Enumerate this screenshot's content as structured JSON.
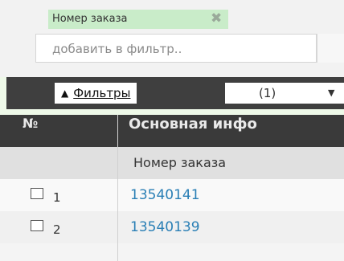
{
  "filter": {
    "chip_label": "Номер заказа",
    "chip_close_glyph": "✖",
    "input_placeholder": "добавить в фильтр..",
    "toggle_label": "Фильтры",
    "toggle_glyph": "▲",
    "count_label": "(1)",
    "dropdown_glyph": "▼"
  },
  "table": {
    "number_col_header": "№",
    "group_header": "Основная инфо",
    "column_header": "Номер заказа",
    "rows": [
      {
        "num": "1",
        "order": "13540141"
      },
      {
        "num": "2",
        "order": "13540139"
      }
    ]
  },
  "colors": {
    "chip_bg": "#c9ecc9",
    "link": "#2a7fb5",
    "dark_bar": "#3f3f3f"
  }
}
